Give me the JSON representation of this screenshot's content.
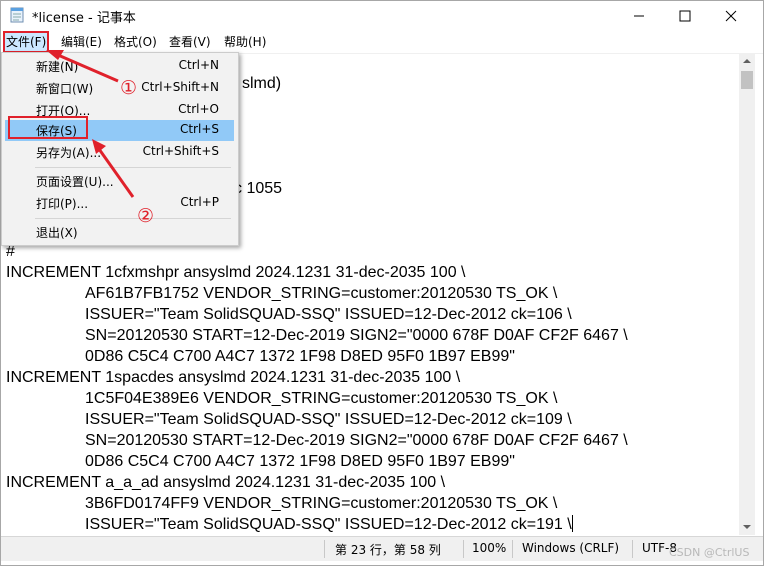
{
  "window": {
    "title": "*license - 记事本"
  },
  "menubar": {
    "items": [
      {
        "label": "文件(F)"
      },
      {
        "label": "编辑(E)"
      },
      {
        "label": "格式(O)"
      },
      {
        "label": "查看(V)"
      },
      {
        "label": "帮助(H)"
      }
    ]
  },
  "file_menu": {
    "items": [
      {
        "label": "新建(N)",
        "shortcut": "Ctrl+N"
      },
      {
        "label": "新窗口(W)",
        "shortcut": "Ctrl+Shift+N"
      },
      {
        "label": "打开(O)...",
        "shortcut": "Ctrl+O"
      },
      {
        "label": "保存(S)",
        "shortcut": "Ctrl+S"
      },
      {
        "label": "另存为(A)...",
        "shortcut": "Ctrl+Shift+S"
      },
      {
        "label": "页面设置(U)...",
        "shortcut": ""
      },
      {
        "label": "打印(P)...",
        "shortcut": "Ctrl+P"
      },
      {
        "label": "退出(X)",
        "shortcut": ""
      }
    ]
  },
  "editor": {
    "partial_lines": {
      "visible_fragment_1": "slmd)",
      "visible_fragment_2": "c 1055"
    },
    "lines": [
      "#",
      "INCREMENT 1cfxmshpr ansyslmd 2024.1231 31-dec-2035 100 \\",
      "AF61B7FB1752 VENDOR_STRING=customer:20120530 TS_OK \\",
      "ISSUER=\"Team SolidSQUAD-SSQ\" ISSUED=12-Dec-2012 ck=106 \\",
      "SN=20120530 START=12-Dec-2019 SIGN2=\"0000 678F D0AF CF2F 6467 \\",
      "0D86 C5C4 C700 A4C7 1372 1F98 D8ED 95F0 1B97 EB99\"",
      "INCREMENT 1spacdes ansyslmd 2024.1231 31-dec-2035 100 \\",
      "1C5F04E389E6 VENDOR_STRING=customer:20120530 TS_OK \\",
      "ISSUER=\"Team SolidSQUAD-SSQ\" ISSUED=12-Dec-2012 ck=109 \\",
      "SN=20120530 START=12-Dec-2019 SIGN2=\"0000 678F D0AF CF2F 6467 \\",
      "0D86 C5C4 C700 A4C7 1372 1F98 D8ED 95F0 1B97 EB99\"",
      "INCREMENT a_a_ad ansyslmd 2024.1231 31-dec-2035 100 \\",
      "3B6FD0174FF9 VENDOR_STRING=customer:20120530 TS_OK \\",
      "ISSUER=\"Team SolidSQUAD-SSQ\" ISSUED=12-Dec-2012 ck=191 \\"
    ]
  },
  "statusbar": {
    "position": "第 23 行，第 58 列",
    "zoom": "100%",
    "line_ending": "Windows (CRLF)",
    "encoding": "UTF-8"
  },
  "annotations": {
    "step1": "①",
    "step2": "②",
    "color": "#e0212b"
  },
  "watermark": "CSDN @CtrlUS"
}
